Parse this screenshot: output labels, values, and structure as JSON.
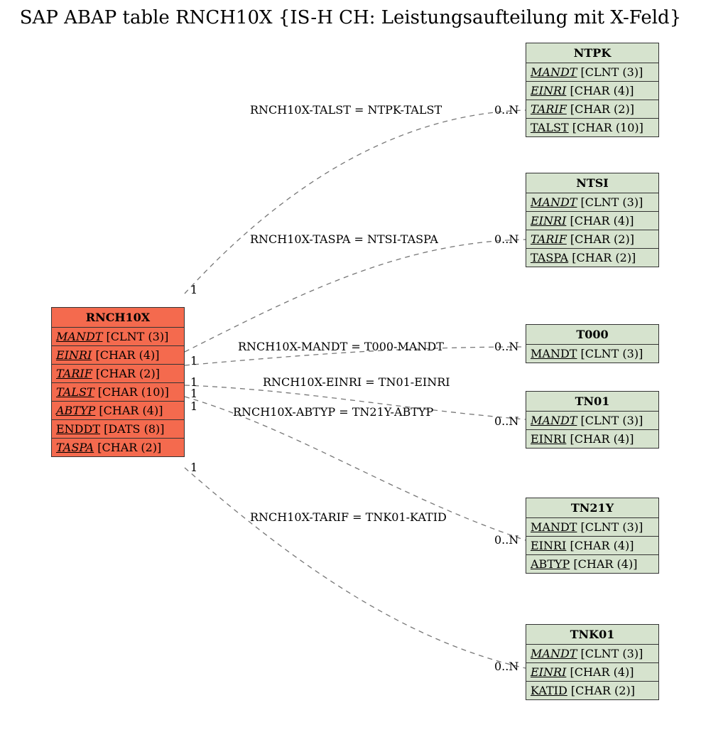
{
  "title": "SAP ABAP table RNCH10X {IS-H CH: Leistungsaufteilung mit X-Feld}",
  "main": {
    "name": "RNCH10X",
    "fields": [
      {
        "n": "MANDT",
        "t": "[CLNT (3)]",
        "i": true
      },
      {
        "n": "EINRI",
        "t": "[CHAR (4)]",
        "i": true
      },
      {
        "n": "TARIF",
        "t": "[CHAR (2)]",
        "i": true
      },
      {
        "n": "TALST",
        "t": "[CHAR (10)]",
        "i": true
      },
      {
        "n": "ABTYP",
        "t": "[CHAR (4)]",
        "i": true
      },
      {
        "n": "ENDDT",
        "t": "[DATS (8)]",
        "i": false
      },
      {
        "n": "TASPA",
        "t": "[CHAR (2)]",
        "i": true
      }
    ]
  },
  "refs": {
    "ntpk": {
      "name": "NTPK",
      "fields": [
        {
          "n": "MANDT",
          "t": "[CLNT (3)]",
          "i": true
        },
        {
          "n": "EINRI",
          "t": "[CHAR (4)]",
          "i": true
        },
        {
          "n": "TARIF",
          "t": "[CHAR (2)]",
          "i": true
        },
        {
          "n": "TALST",
          "t": "[CHAR (10)]",
          "i": false
        }
      ]
    },
    "ntsi": {
      "name": "NTSI",
      "fields": [
        {
          "n": "MANDT",
          "t": "[CLNT (3)]",
          "i": true
        },
        {
          "n": "EINRI",
          "t": "[CHAR (4)]",
          "i": true
        },
        {
          "n": "TARIF",
          "t": "[CHAR (2)]",
          "i": true
        },
        {
          "n": "TASPA",
          "t": "[CHAR (2)]",
          "i": false
        }
      ]
    },
    "t000": {
      "name": "T000",
      "fields": [
        {
          "n": "MANDT",
          "t": "[CLNT (3)]",
          "i": false
        }
      ]
    },
    "tn01": {
      "name": "TN01",
      "fields": [
        {
          "n": "MANDT",
          "t": "[CLNT (3)]",
          "i": true
        },
        {
          "n": "EINRI",
          "t": "[CHAR (4)]",
          "i": false
        }
      ]
    },
    "tn21y": {
      "name": "TN21Y",
      "fields": [
        {
          "n": "MANDT",
          "t": "[CLNT (3)]",
          "i": false
        },
        {
          "n": "EINRI",
          "t": "[CHAR (4)]",
          "i": false
        },
        {
          "n": "ABTYP",
          "t": "[CHAR (4)]",
          "i": false
        }
      ]
    },
    "tnk01": {
      "name": "TNK01",
      "fields": [
        {
          "n": "MANDT",
          "t": "[CLNT (3)]",
          "i": true
        },
        {
          "n": "EINRI",
          "t": "[CHAR (4)]",
          "i": true
        },
        {
          "n": "KATID",
          "t": "[CHAR (2)]",
          "i": false
        }
      ]
    }
  },
  "links": [
    {
      "label": "RNCH10X-TALST = NTPK-TALST",
      "lc": "0..N"
    },
    {
      "label": "RNCH10X-TASPA = NTSI-TASPA",
      "lc": "0..N"
    },
    {
      "label": "RNCH10X-MANDT = T000-MANDT",
      "lc": "0..N"
    },
    {
      "label": "RNCH10X-EINRI = TN01-EINRI",
      "lc": ""
    },
    {
      "label": "RNCH10X-ABTYP = TN21Y-ABTYP",
      "lc": "0..N"
    },
    {
      "label": "RNCH10X-TARIF = TNK01-KATID",
      "lc": "0..N"
    }
  ],
  "card1": "1",
  "card0n": "0..N"
}
